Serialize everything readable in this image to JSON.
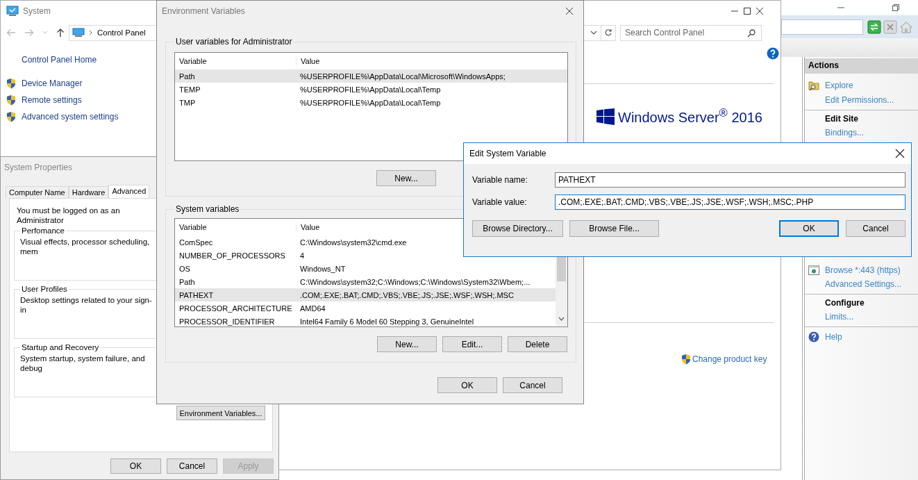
{
  "iis_manager": {
    "actions_header": "Actions",
    "actions": [
      {
        "kind": "explore",
        "text": "Explore"
      },
      {
        "kind": "link",
        "text": "Edit Permissions..."
      },
      {
        "kind": "heading",
        "text": "Edit Site"
      },
      {
        "kind": "link",
        "text": "Bindings..."
      },
      {
        "kind": "browse",
        "text": "Browse *:443 (https)"
      },
      {
        "kind": "link",
        "text": "Advanced Settings..."
      },
      {
        "kind": "heading",
        "text": "Configure"
      },
      {
        "kind": "link",
        "text": "Limits..."
      },
      {
        "kind": "help",
        "text": "Help"
      }
    ]
  },
  "control_panel": {
    "title": "System",
    "breadcrumb": "Control Panel",
    "search_placeholder": "Search Control Panel",
    "home_link": "Control Panel Home",
    "tasks": [
      "Device Manager",
      "Remote settings",
      "Advanced system settings"
    ],
    "edition": "Windows Server$^{®}$ 2016",
    "product_key_link": "Change product key"
  },
  "system_properties": {
    "title": "System Properties",
    "tabs": [
      {
        "label": "Computer Name",
        "selected": false
      },
      {
        "label": "Hardware",
        "selected": false
      },
      {
        "label": "Advanced",
        "selected": true
      }
    ],
    "admin_note": "You must be logged on as an Administrator",
    "groups": [
      {
        "title": "Perfomance",
        "text": "Visual effects, processor scheduling, mem"
      },
      {
        "title": "User Profiles",
        "text": "Desktop settings related to your sign-in"
      },
      {
        "title": "Startup and Recovery",
        "text": "System startup, system failure, and debug"
      }
    ],
    "env_button": "Environment Variables...",
    "buttons": [
      {
        "label": "OK",
        "disabled": false
      },
      {
        "label": "Cancel",
        "disabled": false
      },
      {
        "label": "Apply",
        "disabled": true
      }
    ]
  },
  "environment_variables": {
    "title": "Environment Variables",
    "user_group": "User variables for Administrator",
    "user_columns": [
      "Variable",
      "Value"
    ],
    "user_vars": [
      {
        "name": "Path",
        "value": "%USERPROFILE%\\AppData\\Local\\Microsoft\\WindowsApps;",
        "selected": true
      },
      {
        "name": "TEMP",
        "value": "%USERPROFILE%\\AppData\\Local\\Temp",
        "selected": false
      },
      {
        "name": "TMP",
        "value": "%USERPROFILE%\\AppData\\Local\\Temp",
        "selected": false
      }
    ],
    "user_buttons": [
      "New..."
    ],
    "system_group": "System variables",
    "system_columns": [
      "Variable",
      "Value"
    ],
    "system_vars": [
      {
        "name": "ComSpec",
        "value": "C:\\Windows\\system32\\cmd.exe",
        "selected": false
      },
      {
        "name": "NUMBER_OF_PROCESSORS",
        "value": "4",
        "selected": false
      },
      {
        "name": "OS",
        "value": "Windows_NT",
        "selected": false
      },
      {
        "name": "Path",
        "value": "C:\\Windows\\system32;C:\\Windows;C:\\Windows\\System32\\Wbem;...",
        "selected": false
      },
      {
        "name": "PATHEXT",
        "value": ".COM;.EXE;.BAT;.CMD;.VBS;.VBE;.JS;.JSE;.WSF;.WSH;.MSC",
        "selected": true
      },
      {
        "name": "PROCESSOR_ARCHITECTURE",
        "value": "AMD64",
        "selected": false
      },
      {
        "name": "PROCESSOR_IDENTIFIER",
        "value": "Intel64 Family 6 Model 60 Stepping 3, GenuineIntel",
        "selected": false
      }
    ],
    "system_buttons": [
      "New...",
      "Edit...",
      "Delete"
    ],
    "buttons": [
      "OK",
      "Cancel"
    ]
  },
  "edit_system_variable": {
    "title": "Edit System Variable",
    "name_label": "Variable name:",
    "name_value": "PATHEXT",
    "name_focused": false,
    "value_label": "Variable value:",
    "value_value": ".COM;.EXE;.BAT;.CMD;.VBS;.VBE;.JS;.JSE;.WSF;.WSH;.MSC;.PHP",
    "value_focused": true,
    "buttons": [
      {
        "label": "Browse Directory...",
        "default": false
      },
      {
        "label": "Browse File...",
        "default": false
      },
      {
        "label": "OK",
        "default": true
      },
      {
        "label": "Cancel",
        "default": false
      }
    ]
  }
}
